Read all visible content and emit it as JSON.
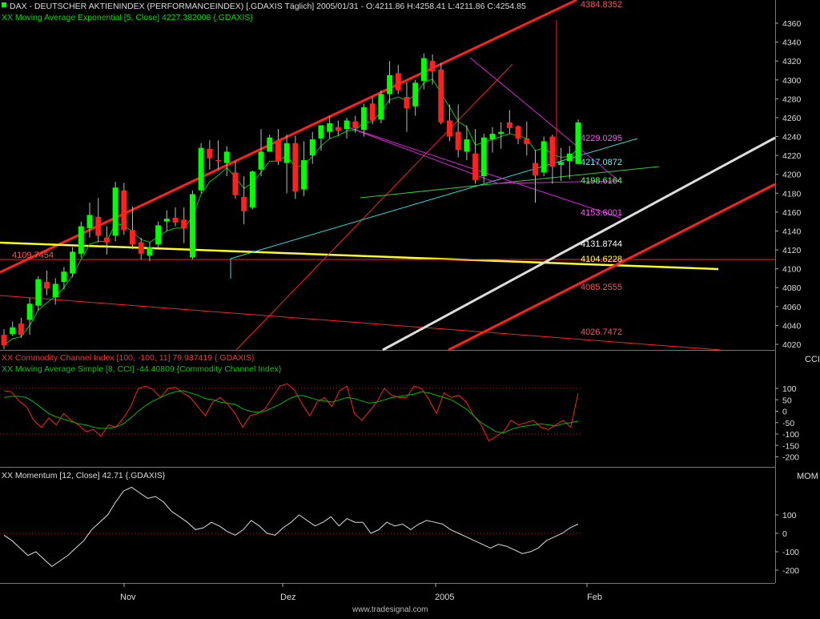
{
  "price_panel": {
    "title_line": "DAX  - DEUTSCHER AKTIENINDEX (PERFORMANCEINDEX) [.GDAXIS  Täglich] 2005/01/31 - O:4211.86 H:4258.41 L:4211.86 C:4254.85",
    "ema_line": "XX Moving Average Exponential [5, Close] 4227.382008 {.GDAXIS}",
    "y_ticks": [
      "4360",
      "4340",
      "4320",
      "4300",
      "4280",
      "4260",
      "4240",
      "4220",
      "4200",
      "4180",
      "4160",
      "4140",
      "4120",
      "4100",
      "4080",
      "4060",
      "4040",
      "4020"
    ],
    "level_labels": [
      {
        "text": "4384.8352",
        "color": "#ff5555"
      },
      {
        "text": "4229.0295",
        "color": "#ff55ff"
      },
      {
        "text": "4217.0872",
        "color": "#55ffff"
      },
      {
        "text": "4198.6164",
        "color": "#66ff66"
      },
      {
        "text": "4153.6001",
        "color": "#ff55ff"
      },
      {
        "text": "4131.8744",
        "color": "#ffffff"
      },
      {
        "text": "4109.7454",
        "color": "#ff5555"
      },
      {
        "text": "4104.6228",
        "color": "#ffff55"
      },
      {
        "text": "4085.2555",
        "color": "#ff5555"
      },
      {
        "text": "4026.7472",
        "color": "#ff5555"
      }
    ]
  },
  "cci_panel": {
    "title_line": "XX Commodity Channel Index [100, -100, 11] 79.937419 {.GDAXIS}",
    "sma_line": "XX Moving Average Simple [8, CCI] -44.40809 {Commodity Channel Index}",
    "right_label": "CCI",
    "y_ticks": [
      "100",
      "50",
      "0",
      "-50",
      "-100",
      "-150",
      "-200"
    ]
  },
  "mom_panel": {
    "title_line": "XX Momentum [12, Close] 42.71 {.GDAXIS}",
    "right_label": "MOM",
    "y_ticks": [
      "100",
      "0",
      "-100",
      "-200"
    ]
  },
  "x_axis": {
    "labels": [
      "Nov",
      "Dez",
      "2005",
      "Feb"
    ]
  },
  "footer": "www.tradesignal.com",
  "colors": {
    "up": "#00ff00",
    "down": "#ff2020",
    "ema": "#00cc00",
    "cci": "#ff2020",
    "cci_sma": "#00bb00",
    "momentum": "#dddddd"
  },
  "chart_data": [
    {
      "type": "candlestick",
      "title": "DAX  - DEUTSCHER AKTIENINDEX (PERFORMANCEINDEX) [.GDAXIS  Täglich]",
      "ylim": [
        4010,
        4375
      ],
      "x_labels": [
        "Nov",
        "Dez",
        "2005",
        "Feb"
      ],
      "candles": [
        [
          4030,
          4036,
          4015,
          4019
        ],
        [
          4031,
          4044,
          4029,
          4038
        ],
        [
          4042,
          4048,
          4027,
          4030
        ],
        [
          4046,
          4069,
          4030,
          4063
        ],
        [
          4061,
          4092,
          4056,
          4089
        ],
        [
          4086,
          4098,
          4072,
          4079
        ],
        [
          4070,
          4090,
          4062,
          4084
        ],
        [
          4086,
          4102,
          4078,
          4097
        ],
        [
          4095,
          4123,
          4091,
          4118
        ],
        [
          4116,
          4150,
          4112,
          4145
        ],
        [
          4143,
          4170,
          4133,
          4157
        ],
        [
          4155,
          4175,
          4128,
          4135
        ],
        [
          4133,
          4145,
          4115,
          4128
        ],
        [
          4135,
          4192,
          4129,
          4186
        ],
        [
          4183,
          4191,
          4136,
          4141
        ],
        [
          4141,
          4166,
          4121,
          4126
        ],
        [
          4128,
          4133,
          4110,
          4116
        ],
        [
          4114,
          4128,
          4108,
          4123
        ],
        [
          4126,
          4150,
          4120,
          4146
        ],
        [
          4150,
          4162,
          4140,
          4153
        ],
        [
          4154,
          4165,
          4145,
          4149
        ],
        [
          4152,
          4165,
          4127,
          4143
        ],
        [
          4112,
          4183,
          4110,
          4179
        ],
        [
          4183,
          4233,
          4180,
          4228
        ],
        [
          4227,
          4236,
          4205,
          4217
        ],
        [
          4215,
          4236,
          4205,
          4214
        ],
        [
          4212,
          4230,
          4198,
          4224
        ],
        [
          4202,
          4214,
          4174,
          4178
        ],
        [
          4176,
          4198,
          4147,
          4161
        ],
        [
          4165,
          4204,
          4163,
          4203
        ],
        [
          4205,
          4248,
          4198,
          4224
        ],
        [
          4224,
          4242,
          4226,
          4239
        ],
        [
          4236,
          4248,
          4210,
          4214
        ],
        [
          4212,
          4242,
          4180,
          4233
        ],
        [
          4233,
          4241,
          4174,
          4182
        ],
        [
          4184,
          4235,
          4177,
          4215
        ],
        [
          4220,
          4245,
          4211,
          4237
        ],
        [
          4238,
          4246,
          4225,
          4252
        ],
        [
          4245,
          4262,
          4238,
          4254
        ],
        [
          4250,
          4257,
          4240,
          4246
        ],
        [
          4248,
          4260,
          4238,
          4257
        ],
        [
          4256,
          4262,
          4244,
          4249
        ],
        [
          4247,
          4275,
          4240,
          4271
        ],
        [
          4275,
          4282,
          4253,
          4257
        ],
        [
          4258,
          4289,
          4254,
          4285
        ],
        [
          4285,
          4320,
          4275,
          4305
        ],
        [
          4307,
          4316,
          4285,
          4289
        ],
        [
          4282,
          4298,
          4245,
          4270
        ],
        [
          4272,
          4300,
          4262,
          4297
        ],
        [
          4299,
          4328,
          4290,
          4323
        ],
        [
          4320,
          4327,
          4295,
          4309
        ],
        [
          4311,
          4318,
          4253,
          4255
        ],
        [
          4257,
          4274,
          4235,
          4240
        ],
        [
          4245,
          4274,
          4218,
          4226
        ],
        [
          4224,
          4252,
          4215,
          4237
        ],
        [
          4222,
          4248,
          4190,
          4194
        ],
        [
          4198,
          4243,
          4191,
          4239
        ],
        [
          4237,
          4250,
          4223,
          4243
        ],
        [
          4243,
          4255,
          4227,
          4245
        ],
        [
          4255,
          4268,
          4243,
          4249
        ],
        [
          4251,
          4252,
          4232,
          4238
        ],
        [
          4238,
          4256,
          4220,
          4232
        ],
        [
          4212,
          4226,
          4170,
          4199
        ],
        [
          4202,
          4240,
          4198,
          4235
        ],
        [
          4240,
          4242,
          4190,
          4208
        ],
        [
          4210,
          4228,
          4193,
          4213
        ],
        [
          4214,
          4230,
          4195,
          4222
        ],
        [
          4211,
          4258,
          4211,
          4255
        ]
      ],
      "ema5": [
        4019,
        4026,
        4028,
        4040,
        4056,
        4064,
        4071,
        4080,
        4093,
        4110,
        4126,
        4129,
        4129,
        4148,
        4146,
        4139,
        4131,
        4128,
        4134,
        4140,
        4143,
        4143,
        4155,
        4179,
        4192,
        4199,
        4207,
        4197,
        4185,
        4191,
        4202,
        4214,
        4214,
        4220,
        4207,
        4210,
        4219,
        4230,
        4238,
        4241,
        4246,
        4247,
        4255,
        4256,
        4266,
        4279,
        4282,
        4278,
        4284,
        4297,
        4301,
        4286,
        4271,
        4256,
        4250,
        4231,
        4234,
        4237,
        4240,
        4243,
        4241,
        4238,
        4225,
        4228,
        4221,
        4218,
        4219,
        4227
      ]
    },
    {
      "type": "line",
      "title": "XX Commodity Channel Index [100, -100, 11]",
      "ylim": [
        -220,
        150
      ],
      "series": [
        {
          "name": "Commodity Channel Index",
          "values": [
            90,
            85,
            45,
            20,
            -40,
            -70,
            -30,
            -60,
            -10,
            -40,
            -60,
            -90,
            -80,
            -110,
            -60,
            -70,
            -30,
            20,
            100,
            110,
            95,
            60,
            100,
            105,
            80,
            60,
            20,
            -20,
            40,
            60,
            30,
            -10,
            -70,
            -20,
            -10,
            10,
            60,
            110,
            120,
            90,
            30,
            -20,
            40,
            60,
            20,
            90,
            110,
            -10,
            -40,
            0,
            40,
            100,
            70,
            60,
            60,
            110,
            100,
            50,
            -10,
            80,
            60,
            70,
            40,
            -20,
            -60,
            -130,
            -110,
            -90,
            -40,
            -60,
            -50,
            -40,
            -70,
            -80,
            -60,
            -40,
            -70,
            80
          ]
        },
        {
          "name": "Moving Average Simple [8, CCI]",
          "values": [
            60,
            65,
            65,
            60,
            40,
            15,
            -10,
            -25,
            -35,
            -45,
            -55,
            -60,
            -70,
            -75,
            -75,
            -70,
            -55,
            -30,
            0,
            25,
            45,
            60,
            75,
            85,
            90,
            80,
            70,
            55,
            50,
            40,
            35,
            30,
            10,
            0,
            -5,
            0,
            15,
            30,
            50,
            65,
            70,
            60,
            50,
            45,
            40,
            50,
            60,
            55,
            45,
            35,
            40,
            50,
            60,
            65,
            70,
            75,
            85,
            80,
            70,
            60,
            50,
            30,
            10,
            -20,
            -50,
            -70,
            -90,
            -95,
            -80,
            -70,
            -65,
            -60,
            -55,
            -60,
            -65,
            -55,
            -50,
            -44
          ]
        }
      ]
    },
    {
      "type": "line",
      "title": "XX Momentum [12, Close]",
      "ylim": [
        -240,
        270
      ],
      "series": [
        {
          "name": "Momentum [12, Close]",
          "values": [
            -10,
            -40,
            -80,
            -120,
            -100,
            -140,
            -180,
            -150,
            -120,
            -80,
            -40,
            20,
            60,
            100,
            170,
            230,
            250,
            220,
            190,
            200,
            170,
            120,
            90,
            60,
            20,
            30,
            60,
            40,
            10,
            -10,
            20,
            70,
            40,
            0,
            -10,
            30,
            60,
            100,
            70,
            40,
            60,
            90,
            40,
            80,
            60,
            60,
            0,
            20,
            60,
            40,
            50,
            20,
            50,
            70,
            60,
            50,
            20,
            0,
            -20,
            -40,
            -60,
            -80,
            -60,
            -70,
            -90,
            -110,
            -100,
            -80,
            -40,
            -20,
            0,
            30,
            50
          ]
        }
      ]
    }
  ]
}
